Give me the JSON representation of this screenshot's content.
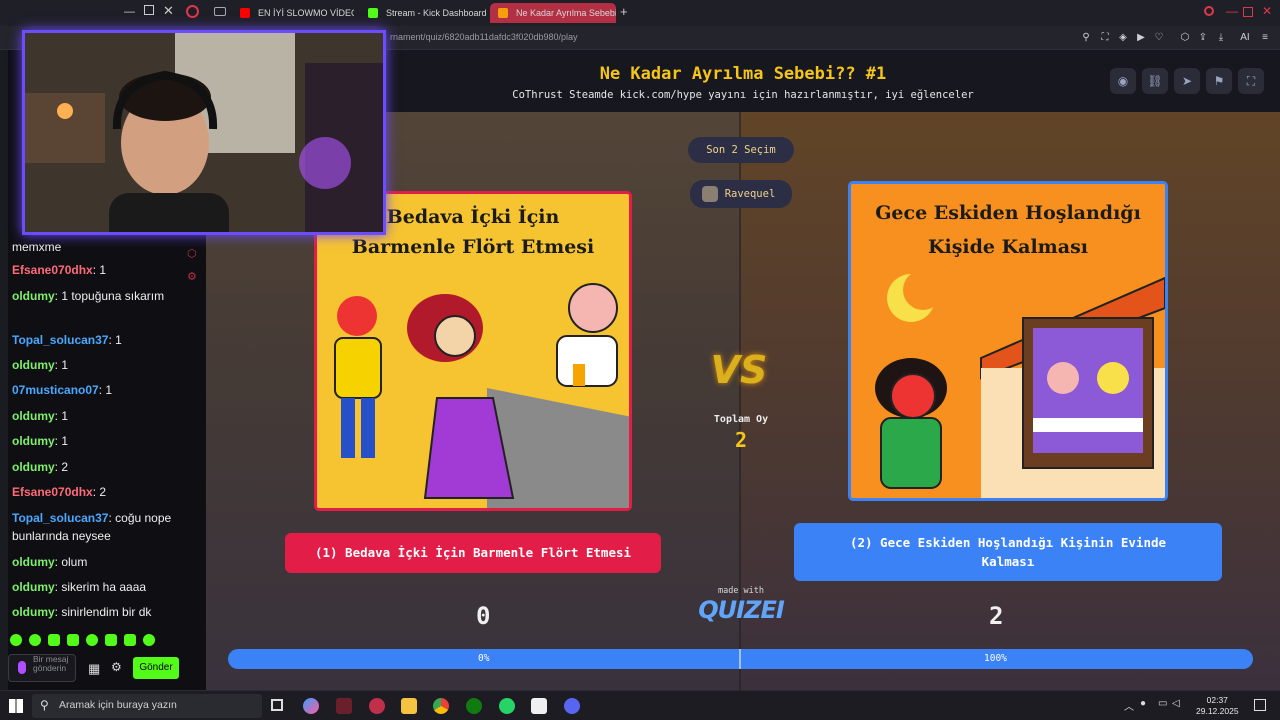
{
  "browser": {
    "tabs": [
      {
        "label": "EN İYİ SLOWMO VİDEOLAR",
        "favicon_color": "#ff0000"
      },
      {
        "label": "Stream - Kick Dashboard",
        "favicon_color": "#53fc18"
      },
      {
        "label": "Ne Kadar Ayrılma Sebebi?",
        "favicon_color": "#f59e0b"
      }
    ],
    "active_tab_index": 2,
    "new_tab": "+",
    "url": "rnament/quiz/6820adb11dafdc3f020db980/play"
  },
  "chat": {
    "messages": [
      {
        "user": "",
        "text": "memxme",
        "color": "#efefef"
      },
      {
        "user": "Efsane070dhx",
        "text": ": 1",
        "color": "#ff6a7a"
      },
      {
        "user": "oldumy",
        "text": ": 1 topuğuna sıkarım",
        "color": "#7df06a"
      },
      {
        "user": "Topal_solucan37",
        "text": ": 1",
        "color": "#4aa8ff"
      },
      {
        "user": "oldumy",
        "text": ": 1",
        "color": "#7df06a"
      },
      {
        "user": "07musticano07",
        "text": ": 1",
        "color": "#4aa8ff"
      },
      {
        "user": "oldumy",
        "text": ": 1",
        "color": "#7df06a"
      },
      {
        "user": "oldumy",
        "text": ": 1",
        "color": "#7df06a"
      },
      {
        "user": "oldumy",
        "text": ": 2",
        "color": "#7df06a"
      },
      {
        "user": "Efsane070dhx",
        "text": ": 2",
        "color": "#ff6a7a"
      },
      {
        "user": "Topal_solucan37",
        "text": ": coğu nope bunlarında neysee",
        "color": "#4aa8ff"
      },
      {
        "user": "oldumy",
        "text": ": olum",
        "color": "#7df06a"
      },
      {
        "user": "oldumy",
        "text": ": sikerim ha aaaa",
        "color": "#7df06a"
      },
      {
        "user": "oldumy",
        "text": ": sinirlendim bir dk",
        "color": "#7df06a"
      }
    ],
    "input_placeholder": "Bir mesaj gönderin",
    "send_label": "Gönder"
  },
  "quiz": {
    "title": "Ne Kadar Ayrılma Sebebi?? #1",
    "subtitle": "CoThrust Steamde kick.com/hype yayını için hazırlanmıştır, iyi eğlenceler",
    "round_pill": "Son 2 Seçim",
    "player_pill": "Ravequel",
    "vs_label": "VS",
    "total_votes_label": "Toplam Oy",
    "total_votes": "2",
    "option1": {
      "card_title_line1": "Bedava İçki İçin",
      "card_title_line2": "Barmenle Flört Etmesi",
      "button": "(1) Bedava İçki İçin Barmenle Flört Etmesi",
      "score": "0",
      "percent": "0%",
      "share": 0
    },
    "option2": {
      "card_title_line1": "Gece Eskiden Hoşlandığı",
      "card_title_line2": "Kişide Kalması",
      "button": "(2) Gece Eskiden Hoşlandığı Kişinin Evinde Kalması",
      "score": "2",
      "percent": "100%",
      "share": 1
    },
    "made_with": "made with",
    "brand": "QUIZEI"
  },
  "taskbar": {
    "search_placeholder": "Aramak için buraya yazın",
    "time": "02:37",
    "date": "29.12.2025"
  },
  "colors": {
    "accent_yellow": "#f5c518",
    "option1_red": "#e11d48",
    "option2_blue": "#3b82f6",
    "kick_green": "#53fc18",
    "webcam_border": "#6b4cff"
  }
}
